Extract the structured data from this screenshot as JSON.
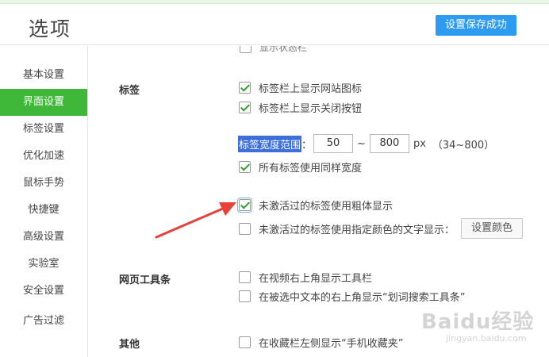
{
  "header": {
    "title": "选项",
    "save_status": "设置保存成功"
  },
  "sidebar": {
    "items": [
      {
        "label": "基本设置",
        "active": false
      },
      {
        "label": "界面设置",
        "active": true
      },
      {
        "label": "标签设置",
        "active": false
      },
      {
        "label": "优化加速",
        "active": false
      },
      {
        "label": "鼠标手势",
        "active": false
      },
      {
        "label": "快捷键",
        "active": false
      },
      {
        "label": "高级设置",
        "active": false
      },
      {
        "label": "实验室",
        "active": false
      },
      {
        "label": "安全设置",
        "active": false
      },
      {
        "label": "广告过滤",
        "active": false
      }
    ]
  },
  "content": {
    "partial_top": {
      "label": "显示状态栏",
      "checked": false
    },
    "tabs_section": {
      "title": "标签",
      "show_site_icon": {
        "label": "标签栏上显示网站图标",
        "checked": true
      },
      "show_close_button": {
        "label": "标签栏上显示关闭按钮",
        "checked": true
      },
      "width_range": {
        "label": "标签宽度范围",
        "colon": "：",
        "min": "50",
        "sep": "~",
        "max": "800",
        "unit": "px",
        "hint": "（34~800）"
      },
      "same_width": {
        "label": "所有标签使用同样宽度",
        "checked": true
      },
      "inactive_bold": {
        "label": "未激活过的标签使用粗体显示",
        "checked": true
      },
      "inactive_color": {
        "label": "未激活过的标签使用指定颜色的文字显示：",
        "checked": false,
        "button": "设置颜色"
      }
    },
    "toolbar_section": {
      "title": "网页工具条",
      "video_toolbar": {
        "label": "在视频右上角显示工具栏",
        "checked": false
      },
      "selection_toolbar": {
        "label": "在被选中文本的右上角显示“划词搜索工具条”",
        "checked": false
      }
    },
    "other_section": {
      "title": "其他",
      "mobile_favorites": {
        "label": "在收藏栏左侧显示“手机收藏夹”",
        "checked": false
      }
    }
  },
  "watermark": {
    "brand": "Baidu经验",
    "url": "jingyan.baidu.com"
  },
  "colors": {
    "accent": "#3fb83a",
    "save_button": "#2d9bf0",
    "arrow": "#e8413a",
    "selection": "#3d6fd9"
  }
}
